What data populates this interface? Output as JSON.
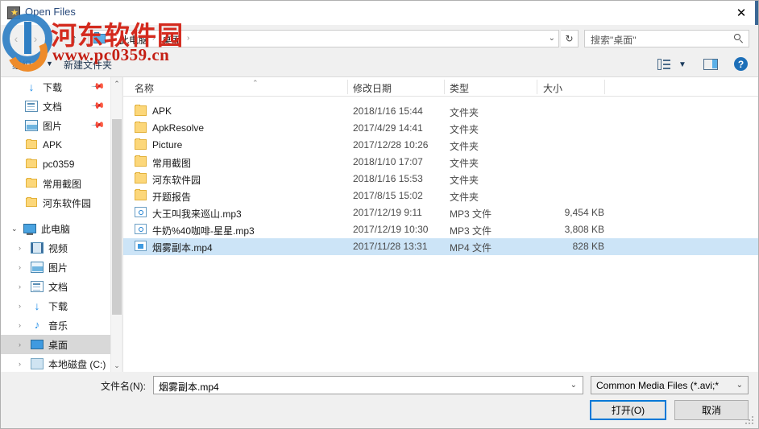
{
  "window": {
    "title": "Open Files",
    "close_label": "✕",
    "title_icon": "app-star-icon"
  },
  "nav": {
    "back": "‹",
    "forward": "›",
    "recent": "⌄",
    "up": "↑",
    "breadcrumb": [
      "此电脑",
      "桌面"
    ],
    "separator": "›",
    "address_dropdown": "⌄",
    "refresh": "↻",
    "search_placeholder": "搜索\"桌面\""
  },
  "commandbar": {
    "organize": "组织",
    "organize_caret": "▼",
    "new_folder": "新建文件夹",
    "view_caret": "▼",
    "help": "?"
  },
  "sidebar": {
    "quick_items": [
      {
        "label": "下载",
        "icon": "download-icon",
        "pinned": true,
        "pin": "📌"
      },
      {
        "label": "文档",
        "icon": "documents-icon",
        "pinned": true,
        "pin": "📌"
      },
      {
        "label": "图片",
        "icon": "pictures-icon",
        "pinned": true,
        "pin": "📌"
      },
      {
        "label": "APK",
        "icon": "folder-icon",
        "pinned": false
      },
      {
        "label": "pc0359",
        "icon": "folder-icon",
        "pinned": false
      },
      {
        "label": "常用截图",
        "icon": "folder-icon",
        "pinned": false
      },
      {
        "label": "河东软件园",
        "icon": "folder-icon",
        "pinned": false
      }
    ],
    "this_pc": {
      "label": "此电脑",
      "icon": "computer-icon",
      "chevron": "⌄"
    },
    "pc_children": [
      {
        "label": "视频",
        "icon": "videos-icon",
        "chevron": "›"
      },
      {
        "label": "图片",
        "icon": "pictures-icon",
        "chevron": "›"
      },
      {
        "label": "文档",
        "icon": "documents-icon",
        "chevron": "›"
      },
      {
        "label": "下载",
        "icon": "download-icon",
        "chevron": "›"
      },
      {
        "label": "音乐",
        "icon": "music-icon",
        "chevron": "›"
      },
      {
        "label": "桌面",
        "icon": "desktop-icon",
        "chevron": "›",
        "selected": true
      },
      {
        "label": "本地磁盘 (C:)",
        "icon": "disk-icon",
        "chevron": "›"
      }
    ],
    "scroll_up": "⌃",
    "scroll_down": "⌄"
  },
  "filelist": {
    "columns": [
      "名称",
      "修改日期",
      "类型",
      "大小"
    ],
    "sort_caret": "⌃",
    "rows": [
      {
        "name": "APK",
        "date": "2018/1/16 15:44",
        "type": "文件夹",
        "size": "",
        "icon": "folder-icon"
      },
      {
        "name": "ApkResolve",
        "date": "2017/4/29 14:41",
        "type": "文件夹",
        "size": "",
        "icon": "folder-icon"
      },
      {
        "name": "Picture",
        "date": "2017/12/28 10:26",
        "type": "文件夹",
        "size": "",
        "icon": "folder-icon"
      },
      {
        "name": "常用截图",
        "date": "2018/1/10 17:07",
        "type": "文件夹",
        "size": "",
        "icon": "folder-icon"
      },
      {
        "name": "河东软件园",
        "date": "2018/1/16 15:53",
        "type": "文件夹",
        "size": "",
        "icon": "folder-icon"
      },
      {
        "name": "开题报告",
        "date": "2017/8/15 15:02",
        "type": "文件夹",
        "size": "",
        "icon": "folder-icon"
      },
      {
        "name": "大王叫我来巡山.mp3",
        "date": "2017/12/19 9:11",
        "type": "MP3 文件",
        "size": "9,454 KB",
        "icon": "mp3-icon"
      },
      {
        "name": "牛奶%40咖啡-星星.mp3",
        "date": "2017/12/19 10:30",
        "type": "MP3 文件",
        "size": "3,808 KB",
        "icon": "mp3-icon"
      },
      {
        "name": "烟雾副本.mp4",
        "date": "2017/11/28 13:31",
        "type": "MP4 文件",
        "size": "828 KB",
        "icon": "mp4-icon",
        "selected": true
      }
    ]
  },
  "footer": {
    "filename_label": "文件名(N):",
    "filename_value": "烟雾副本.mp4",
    "filename_caret": "⌄",
    "filter_value": "Common Media Files (*.avi;*",
    "filter_caret": "⌄",
    "open_button": "打开(O)",
    "cancel_button": "取消"
  },
  "watermark": {
    "text_cn": "河东软件园",
    "text_url": "www.pc0359.cn"
  },
  "colors": {
    "accent": "#0078d7",
    "selection": "#cce4f7",
    "title_text": "#2a4b7c",
    "watermark_red": "#d42a1e"
  }
}
